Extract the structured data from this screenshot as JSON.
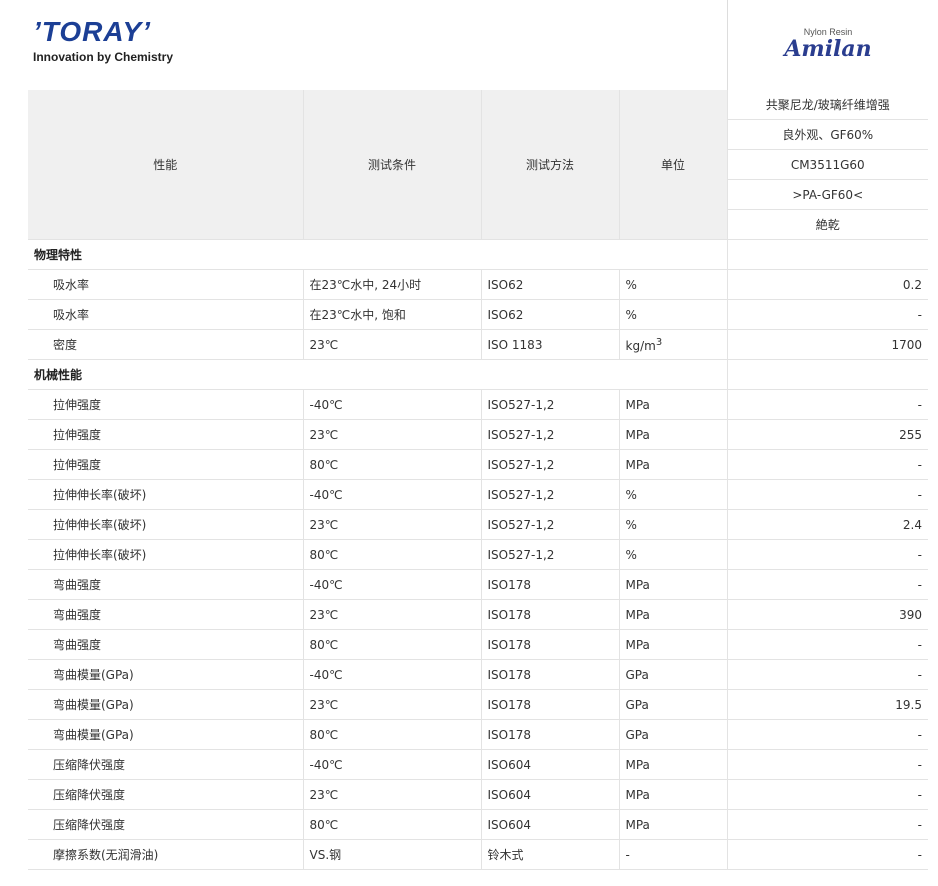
{
  "header": {
    "logo_text": "’TORAY’",
    "tagline": "Innovation by Chemistry",
    "brand_small": "Nylon Resin",
    "brand_name": "Amilan"
  },
  "table": {
    "col_headers": [
      "性能",
      "测试条件",
      "测试方法",
      "单位"
    ],
    "product_info": [
      "共聚尼龙/玻璃纤维增强",
      "良外观、GF60%",
      "CM3511G60",
      ">PA-GF60<",
      "絶乾"
    ],
    "sections": [
      {
        "title": "物理特性",
        "rows": [
          {
            "property": "吸水率",
            "condition": "在23℃水中, 24小时",
            "method": "ISO62",
            "unit": "%",
            "value": "0.2"
          },
          {
            "property": "吸水率",
            "condition": "在23℃水中, 饱和",
            "method": "ISO62",
            "unit": "%",
            "value": "-"
          },
          {
            "property": "密度",
            "condition": "23℃",
            "method": "ISO 1183",
            "unit": "kg/m",
            "unit_sup": "3",
            "value": "1700"
          }
        ]
      },
      {
        "title": "机械性能",
        "rows": [
          {
            "property": "拉伸强度",
            "condition": "-40℃",
            "method": "ISO527-1,2",
            "unit": "MPa",
            "value": "-"
          },
          {
            "property": "拉伸强度",
            "condition": "23℃",
            "method": "ISO527-1,2",
            "unit": "MPa",
            "value": "255"
          },
          {
            "property": "拉伸强度",
            "condition": "80℃",
            "method": "ISO527-1,2",
            "unit": "MPa",
            "value": "-"
          },
          {
            "property": "拉伸伸长率(破坏)",
            "condition": "-40℃",
            "method": "ISO527-1,2",
            "unit": "%",
            "value": "-"
          },
          {
            "property": "拉伸伸长率(破坏)",
            "condition": "23℃",
            "method": "ISO527-1,2",
            "unit": "%",
            "value": "2.4"
          },
          {
            "property": "拉伸伸长率(破坏)",
            "condition": "80℃",
            "method": "ISO527-1,2",
            "unit": "%",
            "value": "-"
          },
          {
            "property": "弯曲强度",
            "condition": "-40℃",
            "method": "ISO178",
            "unit": "MPa",
            "value": "-"
          },
          {
            "property": "弯曲强度",
            "condition": "23℃",
            "method": "ISO178",
            "unit": "MPa",
            "value": "390"
          },
          {
            "property": "弯曲强度",
            "condition": "80℃",
            "method": "ISO178",
            "unit": "MPa",
            "value": "-"
          },
          {
            "property": "弯曲模量(GPa)",
            "condition": "-40℃",
            "method": "ISO178",
            "unit": "GPa",
            "value": "-"
          },
          {
            "property": "弯曲模量(GPa)",
            "condition": "23℃",
            "method": "ISO178",
            "unit": "GPa",
            "value": "19.5"
          },
          {
            "property": "弯曲模量(GPa)",
            "condition": "80℃",
            "method": "ISO178",
            "unit": "GPa",
            "value": "-"
          },
          {
            "property": "压缩降伏强度",
            "condition": "-40℃",
            "method": "ISO604",
            "unit": "MPa",
            "value": "-"
          },
          {
            "property": "压缩降伏强度",
            "condition": "23℃",
            "method": "ISO604",
            "unit": "MPa",
            "value": "-"
          },
          {
            "property": "压缩降伏强度",
            "condition": "80℃",
            "method": "ISO604",
            "unit": "MPa",
            "value": "-"
          },
          {
            "property": "摩擦系数(无润滑油)",
            "condition": "VS.钢",
            "method": "铃木式",
            "unit": "-",
            "value": "-"
          }
        ]
      }
    ]
  }
}
